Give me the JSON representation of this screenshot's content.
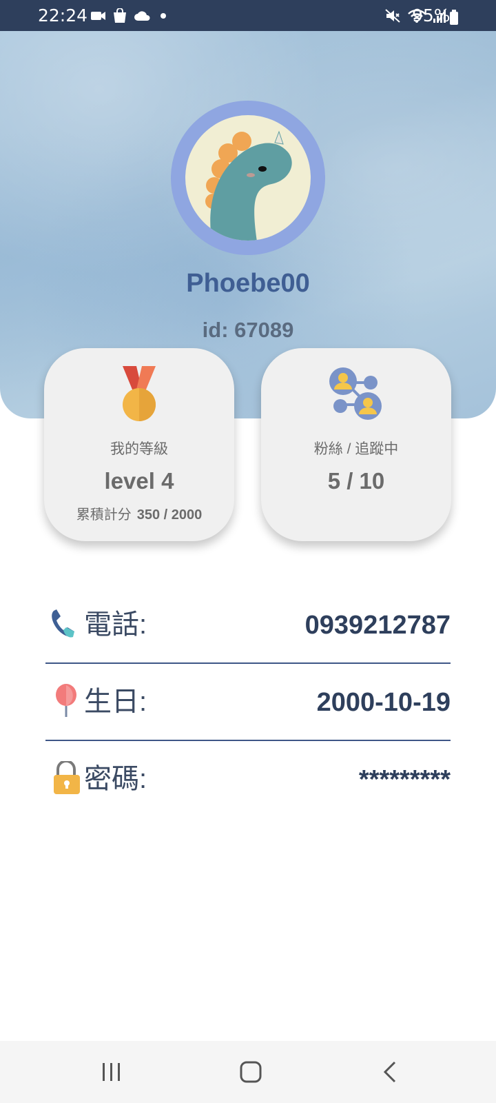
{
  "status_bar": {
    "time": "22:24",
    "battery_text": "95%",
    "icons_left": [
      "video-icon",
      "shopping-bag-icon",
      "cloud-icon",
      "dot-icon"
    ],
    "icons_right": [
      "mute-icon",
      "wifi-icon",
      "signal-icon",
      "battery-icon"
    ]
  },
  "profile": {
    "username": "Phoebe00",
    "id_text": "id: 67089"
  },
  "level_card": {
    "caption": "我的等級",
    "value": "level 4",
    "points_label": "累積計分",
    "points_value": "350 / 2000",
    "icon": "medal-icon"
  },
  "social_card": {
    "caption": "粉絲 / 追蹤中",
    "value": "5 / 10",
    "icon": "network-icon"
  },
  "info": {
    "phone": {
      "label": "電話:",
      "value": "0939212787",
      "icon": "phone-icon"
    },
    "birthday": {
      "label": "生日:",
      "value": "2000-10-19",
      "icon": "balloon-icon"
    },
    "password": {
      "label": "密碼:",
      "value": "*********",
      "icon": "lock-icon"
    }
  },
  "nav_bar": {
    "buttons": [
      "recent-apps-button",
      "home-button",
      "back-button"
    ]
  },
  "colors": {
    "status_bar": "#2e3f5c",
    "username": "#3f5e93",
    "value_text": "#2e3f5c",
    "card_bg": "#f0f0f0",
    "avatar_ring": "#8fa6e1"
  }
}
